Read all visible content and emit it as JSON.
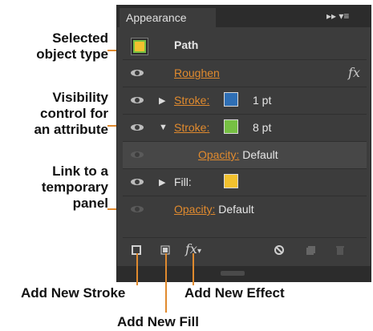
{
  "panel": {
    "tab_title": "Appearance",
    "menu_controls": "▸▸ ▾≡"
  },
  "rows": [
    {
      "name": "Path"
    },
    {
      "name": "Roughen"
    },
    {
      "name": "Stroke:",
      "value": "1 pt",
      "swatch": "#2f6fb5"
    },
    {
      "name": "Stroke:",
      "value": "8 pt",
      "swatch": "#76c043"
    },
    {
      "name": "Opacity:",
      "value": "Default"
    },
    {
      "name": "Fill:",
      "swatch": "#f2c12e"
    },
    {
      "name": "Opacity:",
      "value": "Default"
    }
  ],
  "callouts": {
    "selected_object_type": "Selected\nobject type",
    "visibility_control": "Visibility\ncontrol for\nan attribute",
    "link_temp_panel": "Link to a\ntemporary\npanel",
    "add_new_stroke": "Add New Stroke",
    "add_new_fill": "Add New Fill",
    "add_new_effect": "Add New Effect"
  },
  "colors": {
    "callout_line": "#e08a2e",
    "link": "#e08a2e"
  }
}
